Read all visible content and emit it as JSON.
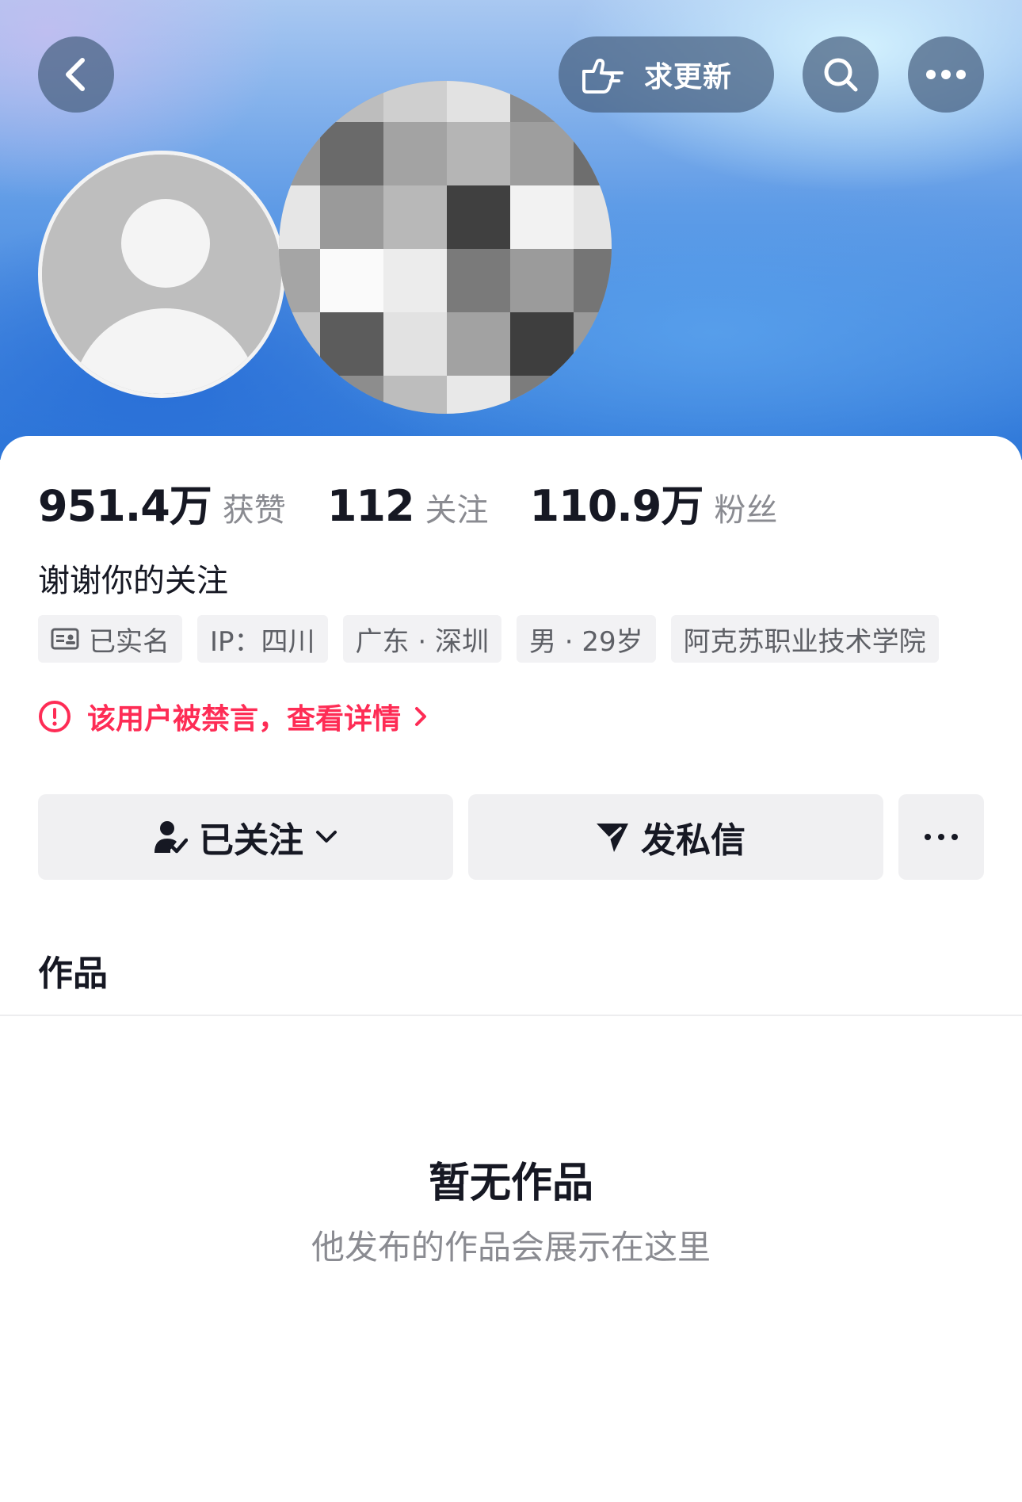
{
  "header": {
    "update_label": "求更新",
    "back_icon": "chevron-left-icon",
    "search_icon": "search-icon",
    "more_icon": "ellipsis-icon"
  },
  "profile": {
    "stats": [
      {
        "value": "951.4万",
        "label": "获赞"
      },
      {
        "value": "112",
        "label": "关注"
      },
      {
        "value": "110.9万",
        "label": "粉丝"
      }
    ],
    "bio": "谢谢你的关注",
    "tags": [
      "已实名",
      "IP：四川",
      "广东 · 深圳",
      "男 · 29岁",
      "阿克苏职业技术学院"
    ],
    "ban_notice": "该用户被禁言，查看详情"
  },
  "actions": {
    "follow_label": "已关注",
    "message_label": "发私信"
  },
  "works": {
    "tab_label": "作品",
    "empty_title": "暂无作品",
    "empty_subtitle": "他发布的作品会展示在这里"
  },
  "colors": {
    "accent_red": "#fe2c55",
    "text_primary": "#161823",
    "text_secondary": "#8a8b91"
  }
}
